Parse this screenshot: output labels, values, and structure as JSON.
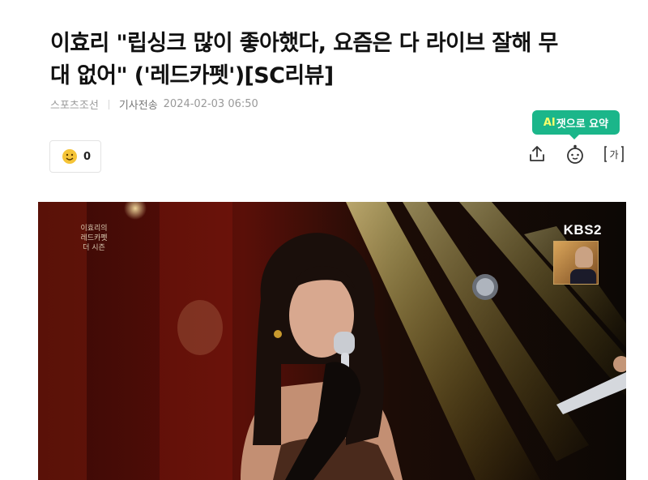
{
  "article": {
    "headline_line1": "이효리 \"립싱크 많이 좋아했다, 요즘은 다 라이브 잘해 무",
    "headline_line2": "대 없어\" ('레드카펫')[SC리뷰]",
    "source": "스포츠조선",
    "dispatch_label": "기사전송",
    "datetime": "2024-02-03 06:50"
  },
  "reactions": {
    "count": "0",
    "icon": "emoji-reaction-icon"
  },
  "toolbar": {
    "ai_tip_prefix": "AI",
    "ai_tip_rest": "잿으로 요약",
    "share_icon": "share-icon",
    "summary_icon": "ai-summary-icon",
    "font_icon": "font-size-icon"
  },
  "video": {
    "broadcaster": "KBS2",
    "show_logo_line1": "이효리의",
    "show_logo_line2": "레드카펫",
    "show_logo_line3": "더 시즌"
  },
  "colors": {
    "accent_green": "#1bb68a",
    "headline": "#111111",
    "meta_gray": "#999999"
  }
}
